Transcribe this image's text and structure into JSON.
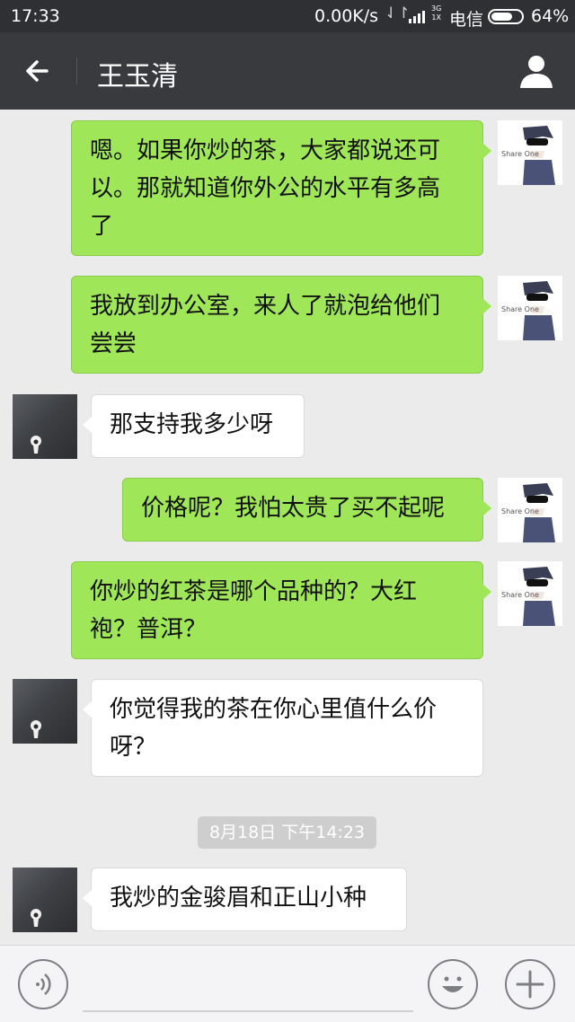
{
  "status_bar": {
    "time": "17:33",
    "speed": "0.00K/s",
    "arrows": "⇃↾",
    "network_top": "3G",
    "network_bottom": "1X",
    "carrier": "电信",
    "battery": "64%"
  },
  "header": {
    "title": "王玉清"
  },
  "messages": [
    {
      "sender": "me",
      "text": "嗯。如果你炒的茶，大家都说还可以。那就知道你外公的水平有多高了"
    },
    {
      "sender": "me",
      "text": "我放到办公室，来人了就泡给他们尝尝"
    },
    {
      "sender": "them",
      "text": "那支持我多少呀"
    },
    {
      "sender": "me",
      "text": "价格呢？我怕太贵了买不起呢"
    },
    {
      "sender": "me",
      "text": "你炒的红茶是哪个品种的？大红袍？普洱？"
    },
    {
      "sender": "them",
      "text": "你觉得我的茶在你心里值什么价呀？"
    },
    {
      "sender": "them",
      "text": "我炒的金骏眉和正山小种"
    }
  ],
  "timestamp": "8月18日 下午14:23",
  "avatar_text": "Share One",
  "colors": {
    "my_bubble": "#9fe658",
    "their_bubble": "#ffffff",
    "title_bar": "#393a3e",
    "status_bar": "#2f3033",
    "chat_background": "#ebebeb"
  }
}
